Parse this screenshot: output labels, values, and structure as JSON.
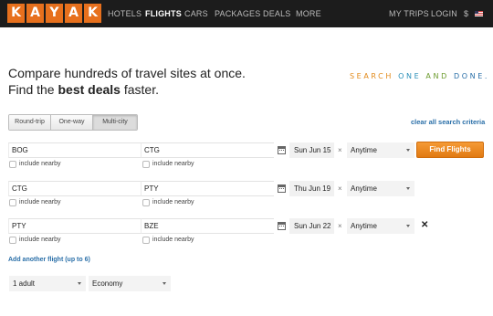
{
  "brand": {
    "letters": [
      "K",
      "A",
      "Y",
      "A",
      "K"
    ]
  },
  "nav": {
    "items": [
      "HOTELS",
      "FLIGHTS",
      "CARS",
      "PACKAGES",
      "DEALS",
      "MORE"
    ],
    "my_trips": "MY TRIPS",
    "login": "LOGIN",
    "currency": "$"
  },
  "hero": {
    "line1": "Compare hundreds of travel sites at once.",
    "line2_prefix": "Find the ",
    "line2_bold": "best deals",
    "line2_suffix": " faster.",
    "tagline_words": [
      "SEARCH",
      "ONE",
      "AND",
      "DONE."
    ],
    "tagline_colors": [
      "#e28a1a",
      "#2a8fb8",
      "#6c9b2e",
      "#2a6fa8"
    ]
  },
  "trip_types": {
    "options": [
      "Round-trip",
      "One-way",
      "Multi-city"
    ],
    "selected": "Multi-city"
  },
  "clear_searches": "clear all search criteria",
  "flights": [
    {
      "origin": "BOG",
      "destination": "CTG",
      "date": "Sun Jun 15",
      "time": "Anytime",
      "origin_nearby": "include nearby",
      "dest_nearby": "include nearby",
      "removable": false
    },
    {
      "origin": "CTG",
      "destination": "PTY",
      "date": "Thu Jun 19",
      "time": "Anytime",
      "origin_nearby": "include nearby",
      "dest_nearby": "include nearby",
      "removable": false
    },
    {
      "origin": "PTY",
      "destination": "BZE",
      "date": "Sun Jun 22",
      "time": "Anytime",
      "origin_nearby": "include nearby",
      "dest_nearby": "include nearby",
      "removable": true
    }
  ],
  "separator": "×",
  "remove_glyph": "✕",
  "find_button": "Find Flights",
  "add_flight": "Add another flight (up to 6)",
  "travelers": {
    "value": "1 adult"
  },
  "cabin": {
    "value": "Economy"
  },
  "accent_color": "#e7701d"
}
